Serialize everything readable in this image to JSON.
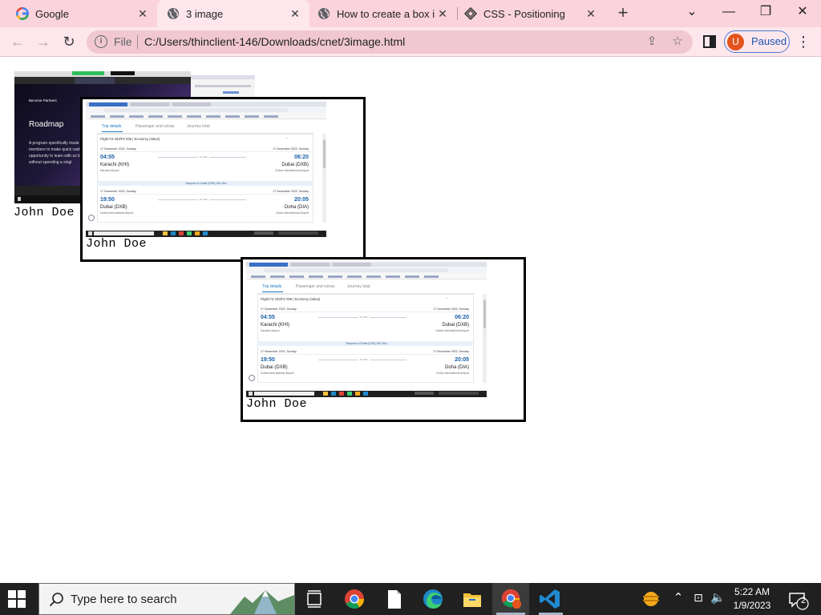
{
  "browser": {
    "tabs": [
      {
        "title": "Google",
        "favicon": "google-icon",
        "active": false
      },
      {
        "title": "3 image",
        "favicon": "globe-icon",
        "active": true
      },
      {
        "title": "How to create a box in",
        "favicon": "globe-icon",
        "active": false
      },
      {
        "title": "CSS - Positioning",
        "favicon": "tutorialspoint-icon",
        "active": false
      }
    ],
    "address": {
      "scheme_label": "File",
      "url": "C:/Users/thinclient-146/Downloads/cnet/3image.html"
    },
    "profile": {
      "initial": "U",
      "label": "Paused"
    }
  },
  "page": {
    "figures": [
      {
        "caption": "John Doe",
        "screenshot_kind": "roadmap-slide"
      },
      {
        "caption": "John Doe",
        "screenshot_kind": "flight-trip-details"
      },
      {
        "caption": "John Doe",
        "screenshot_kind": "flight-trip-details"
      }
    ],
    "roadmap": {
      "heading": "Roadmap",
      "label": "Become Partners",
      "body": "A program specifically made members to make quick cash opportunity to learn with us time without spending a singl"
    },
    "flight": {
      "tabs": [
        "Trip details",
        "Passenger and extras",
        "Journey total"
      ],
      "flight_title": "Flight FZ 333/FZ 005 | Economy (Value)",
      "segments": [
        {
          "date_dep": "17 November 2022, Sunday",
          "date_arr": "17 November 2022, Sunday",
          "dep_time": "04:55",
          "arr_time": "06:20",
          "dep_city": "Karachi (KHI)",
          "arr_city": "Dubai (DXB)",
          "dep_airport": "Karachi Airport",
          "arr_airport": "Dubai International Airport",
          "duration": "1h 25m"
        },
        {
          "date_dep": "17 November 2022, Sunday",
          "date_arr": "17 November 2022, Sunday",
          "dep_time": "19:50",
          "arr_time": "20:05",
          "dep_city": "Dubai (DXB)",
          "arr_city": "Doha (DIA)",
          "dep_airport": "Dubai International Airport",
          "arr_airport": "Doha International Airport",
          "duration": "1h 15m"
        }
      ],
      "stopover": "Stopover in Dubai (DXB) 13h 30m"
    }
  },
  "taskbar": {
    "search_placeholder": "Type here to search",
    "time": "5:22 AM",
    "date": "1/9/2023",
    "notification_count": "2"
  },
  "colors": {
    "tabbar_bg": "#fbd3dc",
    "toolbar_bg": "#fde7ec",
    "taskbar_bg": "#202020",
    "accent_blue": "#1a56b3"
  }
}
